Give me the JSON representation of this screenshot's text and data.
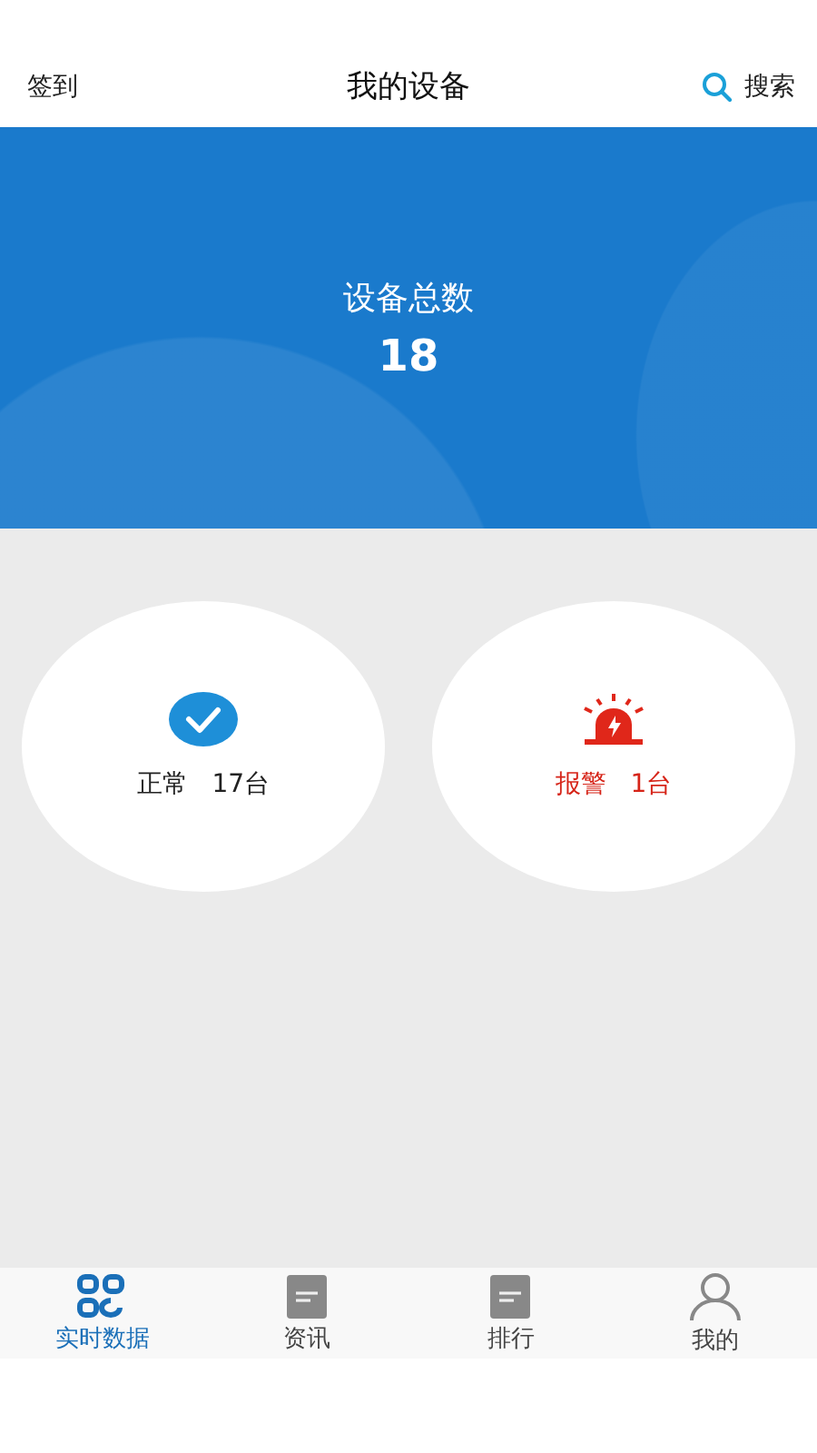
{
  "header": {
    "left": "签到",
    "title": "我的设备",
    "search": "搜索"
  },
  "summary": {
    "label": "设备总数",
    "value": "18"
  },
  "statuses": [
    {
      "kind": "normal",
      "label": "正常",
      "count": "17台"
    },
    {
      "kind": "alarm",
      "label": "报警",
      "count": "1台"
    }
  ],
  "tabs": [
    {
      "kind": "grid",
      "label": "实时数据",
      "selected": true
    },
    {
      "kind": "doc",
      "label": "资讯",
      "selected": false
    },
    {
      "kind": "doc",
      "label": "排行",
      "selected": false
    },
    {
      "kind": "person",
      "label": "我的",
      "selected": false
    }
  ]
}
